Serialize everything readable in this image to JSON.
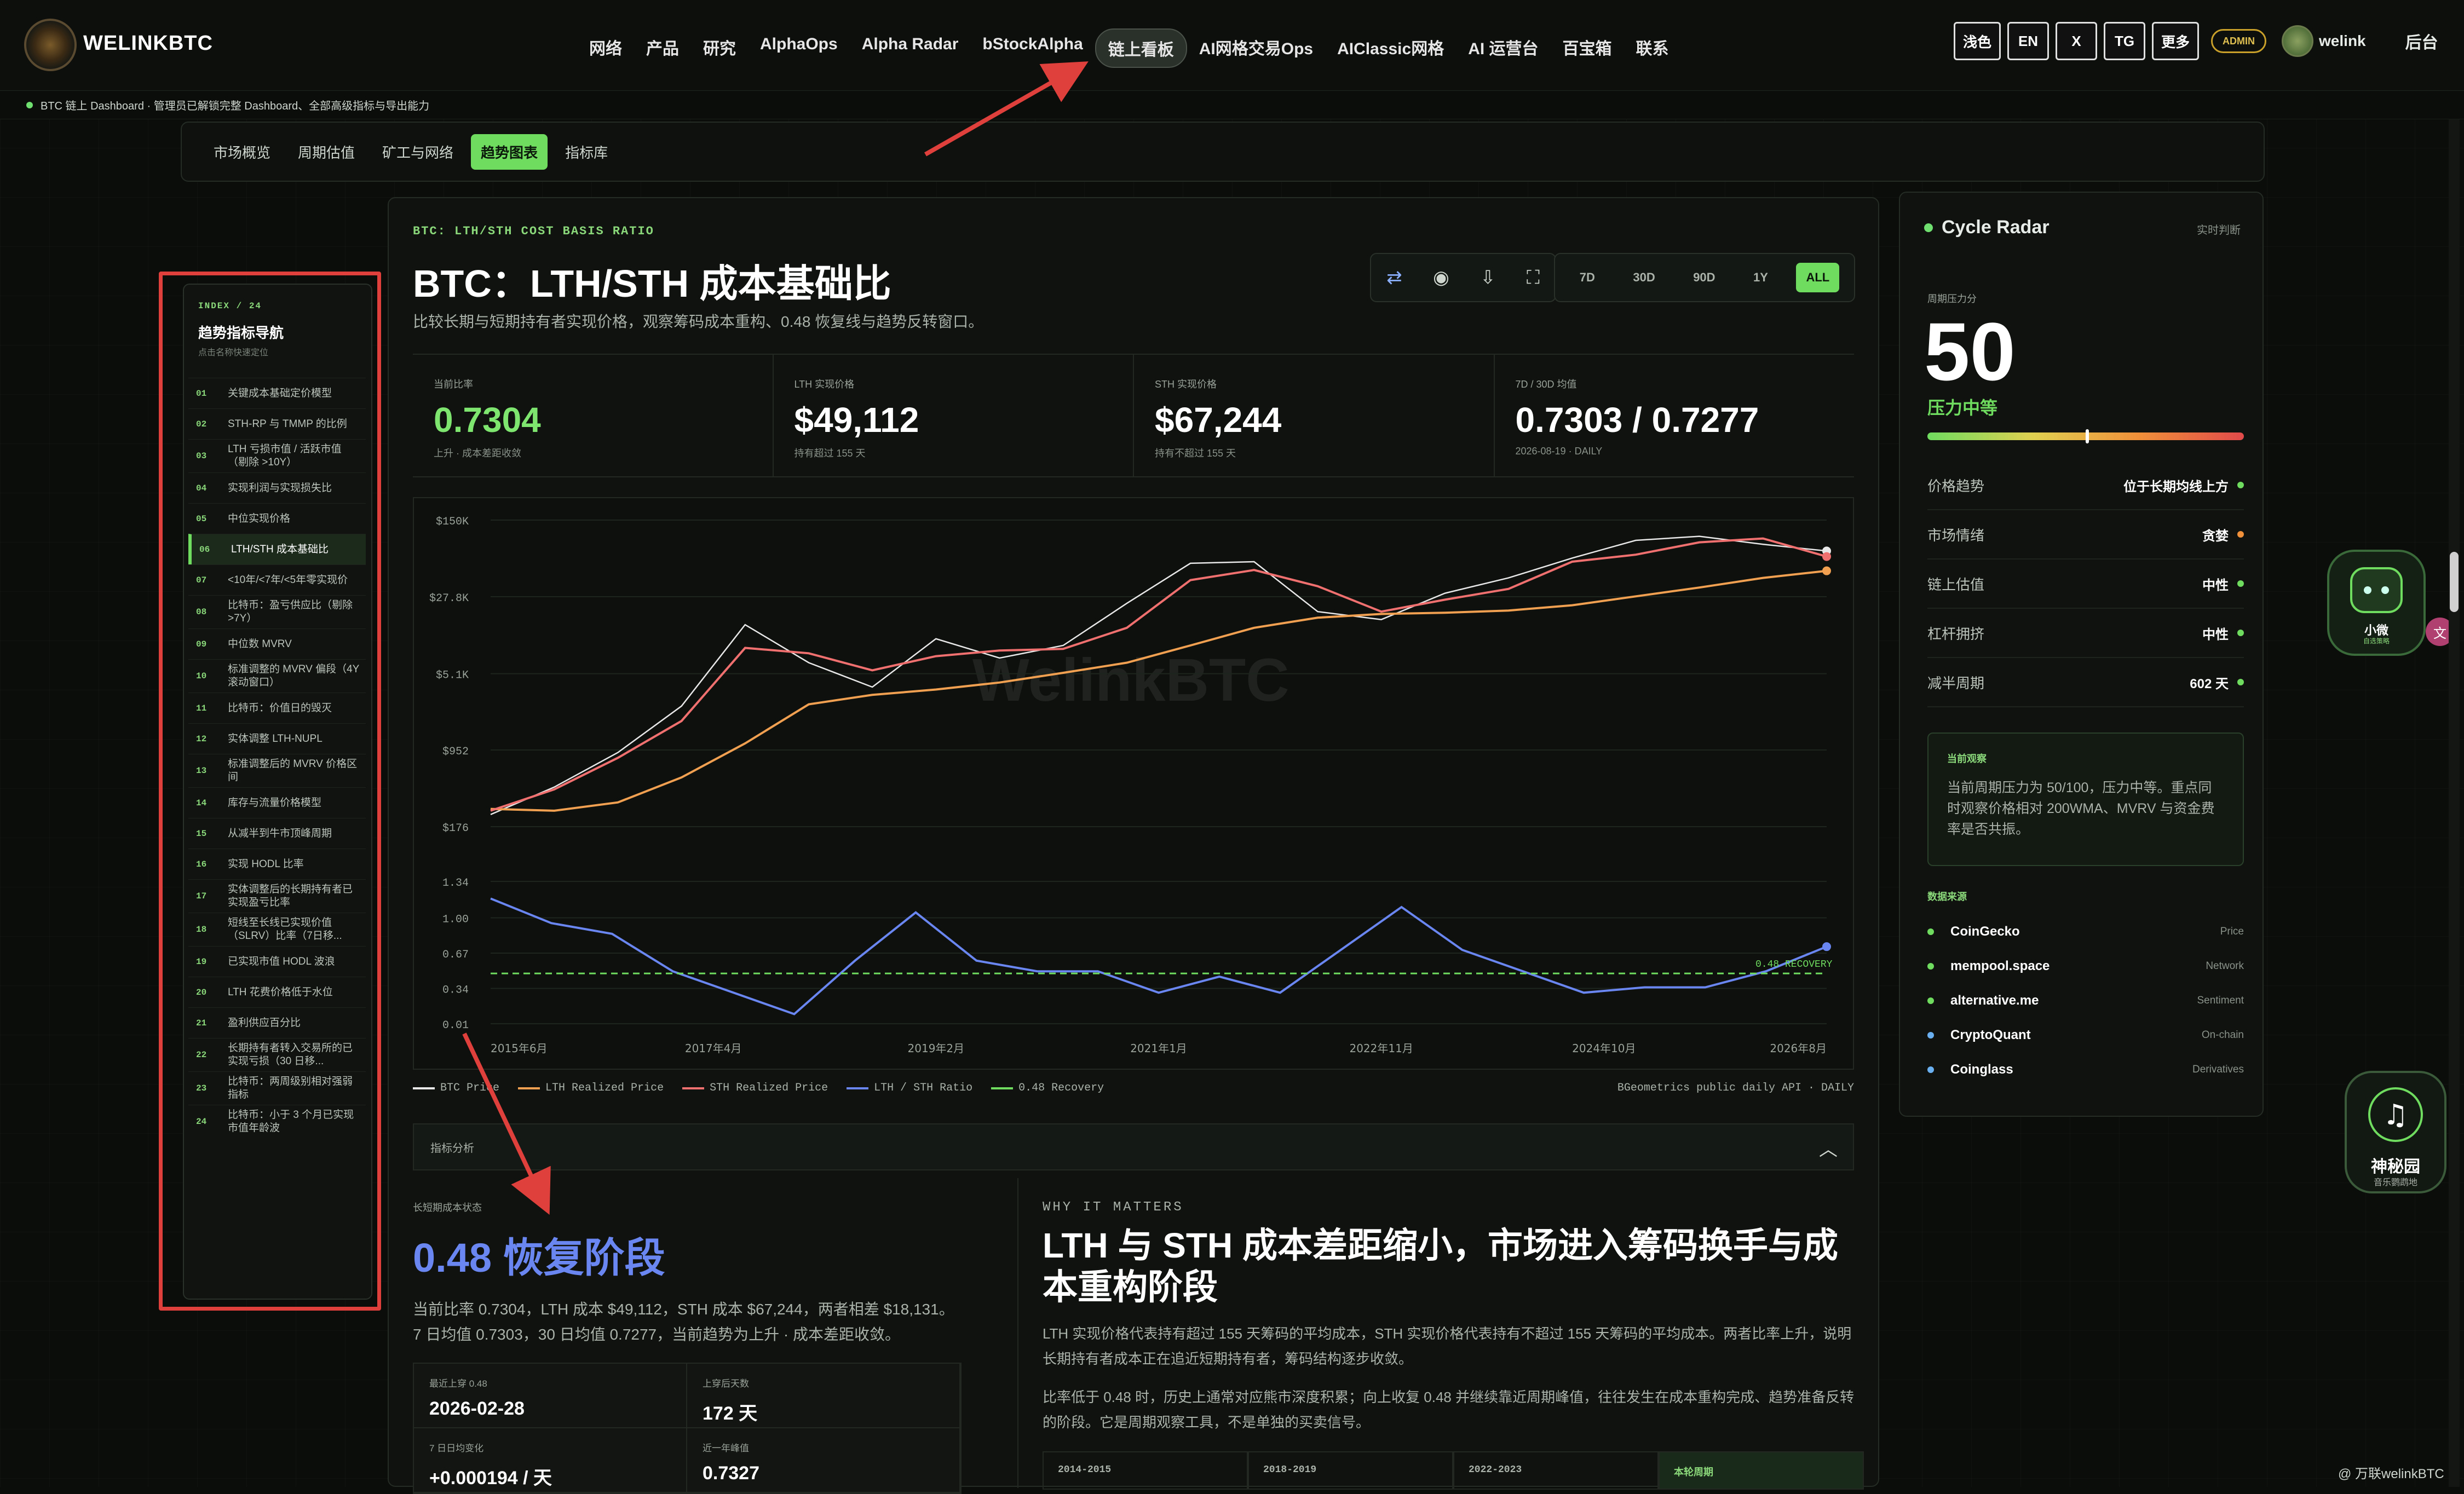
{
  "brand": {
    "name": "WELINKBTC"
  },
  "nav": {
    "items": [
      "网络",
      "产品",
      "研究",
      "AlphaOps",
      "Alpha Radar",
      "bStockAlpha",
      "链上看板",
      "AI网格交易Ops",
      "AIClassic网格",
      "AI 运营台",
      "百宝箱",
      "联系"
    ],
    "active": "链上看板",
    "tools": [
      "浅色",
      "EN",
      "X",
      "TG",
      "更多"
    ],
    "admin": "ADMIN",
    "user": "welink",
    "backend": "后台"
  },
  "status": {
    "text": "BTC 链上 Dashboard · 管理员已解锁完整 Dashboard、全部高级指标与导出能力"
  },
  "subtabs": {
    "items": [
      "市场概览",
      "周期估值",
      "矿工与网络",
      "趋势图表",
      "指标库"
    ],
    "active": "趋势图表"
  },
  "leftnav": {
    "index": "INDEX / 24",
    "title": "趋势指标导航",
    "subtitle": "点击名称快速定位",
    "items": [
      {
        "n": "01",
        "t": "关键成本基础定价模型"
      },
      {
        "n": "02",
        "t": "STH-RP 与 TMMP 的比例"
      },
      {
        "n": "03",
        "t": "LTH 亏损市值 / 活跃市值（剔除 >10Y）"
      },
      {
        "n": "04",
        "t": "实现利润与实现损失比"
      },
      {
        "n": "05",
        "t": "中位实现价格"
      },
      {
        "n": "06",
        "t": "LTH/STH 成本基础比"
      },
      {
        "n": "07",
        "t": "<10年/<7年/<5年零实现价"
      },
      {
        "n": "08",
        "t": "比特币：盈亏供应比（剔除 >7Y）"
      },
      {
        "n": "09",
        "t": "中位数 MVRV"
      },
      {
        "n": "10",
        "t": "标准调整的 MVRV 偏段（4Y 滚动窗口）"
      },
      {
        "n": "11",
        "t": "比特币：价值日的毁灭"
      },
      {
        "n": "12",
        "t": "实体调整 LTH-NUPL"
      },
      {
        "n": "13",
        "t": "标准调整后的 MVRV 价格区间"
      },
      {
        "n": "14",
        "t": "库存与流量价格模型"
      },
      {
        "n": "15",
        "t": "从减半到牛市顶峰周期"
      },
      {
        "n": "16",
        "t": "实现 HODL 比率"
      },
      {
        "n": "17",
        "t": "实体调整后的长期持有者已实现盈亏比率"
      },
      {
        "n": "18",
        "t": "短线至长线已实现价值（SLRV）比率（7日移..."
      },
      {
        "n": "19",
        "t": "已实现市值 HODL 波浪"
      },
      {
        "n": "20",
        "t": "LTH 花费价格低于水位"
      },
      {
        "n": "21",
        "t": "盈利供应百分比"
      },
      {
        "n": "22",
        "t": "长期持有者转入交易所的已实现亏损（30 日移..."
      },
      {
        "n": "23",
        "t": "比特币：两周级别相对强弱指标"
      },
      {
        "n": "24",
        "t": "比特币：小于 3 个月已实现市值年龄波"
      }
    ],
    "active": "06"
  },
  "main": {
    "label": "BTC: LTH/STH COST BASIS RATIO",
    "title": "BTC：LTH/STH 成本基础比",
    "desc": "比较长期与短期持有者实现价格，观察筹码成本重构、0.48 恢复线与趋势反转窗口。",
    "icons": [
      "swap-icon",
      "record-icon",
      "download-icon",
      "fullscreen-icon"
    ],
    "ranges": [
      "7D",
      "30D",
      "90D",
      "1Y",
      "ALL"
    ],
    "active_range": "ALL",
    "stats": [
      {
        "k": "当前比率",
        "v": "0.7304",
        "s": "上升 · 成本差距收敛",
        "green": true
      },
      {
        "k": "LTH 实现价格",
        "v": "$49,112",
        "s": "持有超过 155 天"
      },
      {
        "k": "STH 实现价格",
        "v": "$67,244",
        "s": "持有不超过 155 天"
      },
      {
        "k": "7D / 30D 均值",
        "v": "0.7303 / 0.7277",
        "s": "2026-08-19 · DAILY"
      }
    ]
  },
  "chart_data": {
    "type": "line",
    "upper": {
      "yscale": "log",
      "yticks": [
        "$150K",
        "$27.8K",
        "$5.1K",
        "$952",
        "$176"
      ],
      "ytick_values": [
        150000,
        27800,
        5100,
        952,
        176
      ],
      "x": [
        "2015-06",
        "2016-03",
        "2016-12",
        "2017-06",
        "2017-12",
        "2018-06",
        "2018-12",
        "2019-06",
        "2019-12",
        "2020-06",
        "2020-12",
        "2021-04",
        "2021-11",
        "2022-06",
        "2022-12",
        "2023-06",
        "2023-12",
        "2024-06",
        "2024-12",
        "2025-06",
        "2025-12",
        "2026-08"
      ],
      "series": [
        {
          "name": "BTC Price",
          "color": "#e8e8e8",
          "values": [
            230,
            420,
            900,
            2500,
            15000,
            6500,
            3800,
            11000,
            7200,
            9500,
            24000,
            58000,
            60000,
            20000,
            16800,
            30000,
            42000,
            65000,
            96000,
            105000,
            88000,
            76000
          ]
        },
        {
          "name": "LTH Realized Price",
          "color": "#f0a050",
          "values": [
            260,
            250,
            300,
            520,
            1100,
            2600,
            3200,
            3600,
            4200,
            5200,
            6500,
            9500,
            14000,
            17500,
            19000,
            19500,
            20500,
            23000,
            28000,
            34000,
            42000,
            49112
          ]
        },
        {
          "name": "STH Realized Price",
          "color": "#f07070",
          "values": [
            250,
            400,
            800,
            1800,
            9000,
            8000,
            5500,
            7500,
            8500,
            8800,
            14000,
            40000,
            50000,
            35000,
            20000,
            26000,
            33000,
            60000,
            70000,
            92000,
            100000,
            67244
          ]
        }
      ]
    },
    "lower": {
      "yticks": [
        "1.34",
        "1.00",
        "0.67",
        "0.34",
        "0.01"
      ],
      "ymin": 0.01,
      "ymax": 1.34,
      "recovery_label": "0.48 RECOVERY",
      "x": [
        "2015-06",
        "2016-01",
        "2016-06",
        "2017-01",
        "2017-06",
        "2018-01",
        "2018-06",
        "2018-12",
        "2019-06",
        "2019-12",
        "2020-06",
        "2020-12",
        "2021-06",
        "2021-12",
        "2022-06",
        "2022-12",
        "2023-06",
        "2023-12",
        "2024-06",
        "2024-12",
        "2025-06",
        "2025-12",
        "2026-08"
      ],
      "series": [
        {
          "name": "LTH / STH Ratio",
          "color": "#6a86f0",
          "values": [
            1.18,
            0.95,
            0.85,
            0.5,
            0.3,
            0.1,
            0.6,
            1.05,
            0.6,
            0.5,
            0.5,
            0.3,
            0.45,
            0.3,
            0.7,
            1.1,
            0.7,
            0.5,
            0.3,
            0.35,
            0.35,
            0.5,
            0.7304
          ]
        },
        {
          "name": "0.48 Recovery",
          "color": "#6fdc5f",
          "values": [
            0.48,
            0.48,
            0.48,
            0.48,
            0.48,
            0.48,
            0.48,
            0.48,
            0.48,
            0.48,
            0.48,
            0.48,
            0.48,
            0.48,
            0.48,
            0.48,
            0.48,
            0.48,
            0.48,
            0.48,
            0.48,
            0.48,
            0.48
          ]
        }
      ]
    },
    "xticks": [
      "2015年6月",
      "2017年4月",
      "2019年2月",
      "2021年1月",
      "2022年11月",
      "2024年10月",
      "2026年8月"
    ],
    "watermark": "WelinkBTC",
    "legend": [
      "BTC Price",
      "LTH Realized Price",
      "STH Realized Price",
      "LTH / STH Ratio",
      "0.48 Recovery"
    ],
    "source": "BGeometrics public daily API · DAILY"
  },
  "analysis": {
    "header": "指标分析",
    "state_label": "长短期成本状态",
    "state": "0.48 恢复阶段",
    "desc": "当前比率 0.7304，LTH 成本 $49,112，STH 成本 $67,244，两者相差 $18,131。7 日均值 0.7303，30 日均值 0.7277，当前趋势为上升 · 成本差距收敛。",
    "cells": [
      {
        "k": "最近上穿 0.48",
        "v": "2026-02-28"
      },
      {
        "k": "上穿后天数",
        "v": "172 天"
      },
      {
        "k": "7 日日均变化",
        "v": "+0.000194 / 天"
      },
      {
        "k": "近一年峰值",
        "v": "0.7327"
      }
    ],
    "why": "WHY IT MATTERS",
    "why_title": "LTH 与 STH 成本差距缩小，市场进入筹码换手与成本重构阶段",
    "p1": "LTH 实现价格代表持有超过 155 天筹码的平均成本，STH 实现价格代表持有不超过 155 天筹码的平均成本。两者比率上升，说明长期持有者成本正在追近短期持有者，筹码结构逐步收敛。",
    "p2": "比率低于 0.48 时，历史上通常对应熊市深度积累；向上收复 0.48 并继续靠近周期峰值，往往发生在成本重构完成、趋势准备反转的阶段。它是周期观察工具，不是单独的买卖信号。",
    "eras": [
      "2014-2015",
      "2018-2019",
      "2022-2023",
      "本轮周期"
    ]
  },
  "radar": {
    "title": "Cycle Radar",
    "tag": "实时判断",
    "score_label": "周期压力分",
    "score": "50",
    "level": "压力中等",
    "gauge_fraction": 0.5,
    "rows": [
      {
        "k": "价格趋势",
        "v": "位于长期均线上方",
        "c": "#6fdc5f"
      },
      {
        "k": "市场情绪",
        "v": "贪婪",
        "c": "#f0903a"
      },
      {
        "k": "链上估值",
        "v": "中性",
        "c": "#6fdc5f"
      },
      {
        "k": "杠杆拥挤",
        "v": "中性",
        "c": "#6fdc5f"
      },
      {
        "k": "减半周期",
        "v": "602 天",
        "c": "#6fdc5f"
      }
    ],
    "obs_title": "当前观察",
    "obs": "当前周期压力为 50/100，压力中等。重点同时观察价格相对 200WMA、MVRV 与资金费率是否共振。",
    "ds_title": "数据来源",
    "sources": [
      {
        "n": "CoinGecko",
        "c": "Price",
        "col": "#6fdc5f"
      },
      {
        "n": "mempool.space",
        "c": "Network",
        "col": "#6fdc5f"
      },
      {
        "n": "alternative.me",
        "c": "Sentiment",
        "col": "#6fdc5f"
      },
      {
        "n": "CryptoQuant",
        "c": "On-chain",
        "col": "#6ab0f0"
      },
      {
        "n": "Coinglass",
        "c": "Derivatives",
        "col": "#6ab0f0"
      }
    ]
  },
  "floats": {
    "bot_name": "小微",
    "bot_sub": "自选策略",
    "garden": "神秘园",
    "garden_sub": "音乐鹦鹉地"
  },
  "footer_watermark": "@ 万联welinkBTC"
}
